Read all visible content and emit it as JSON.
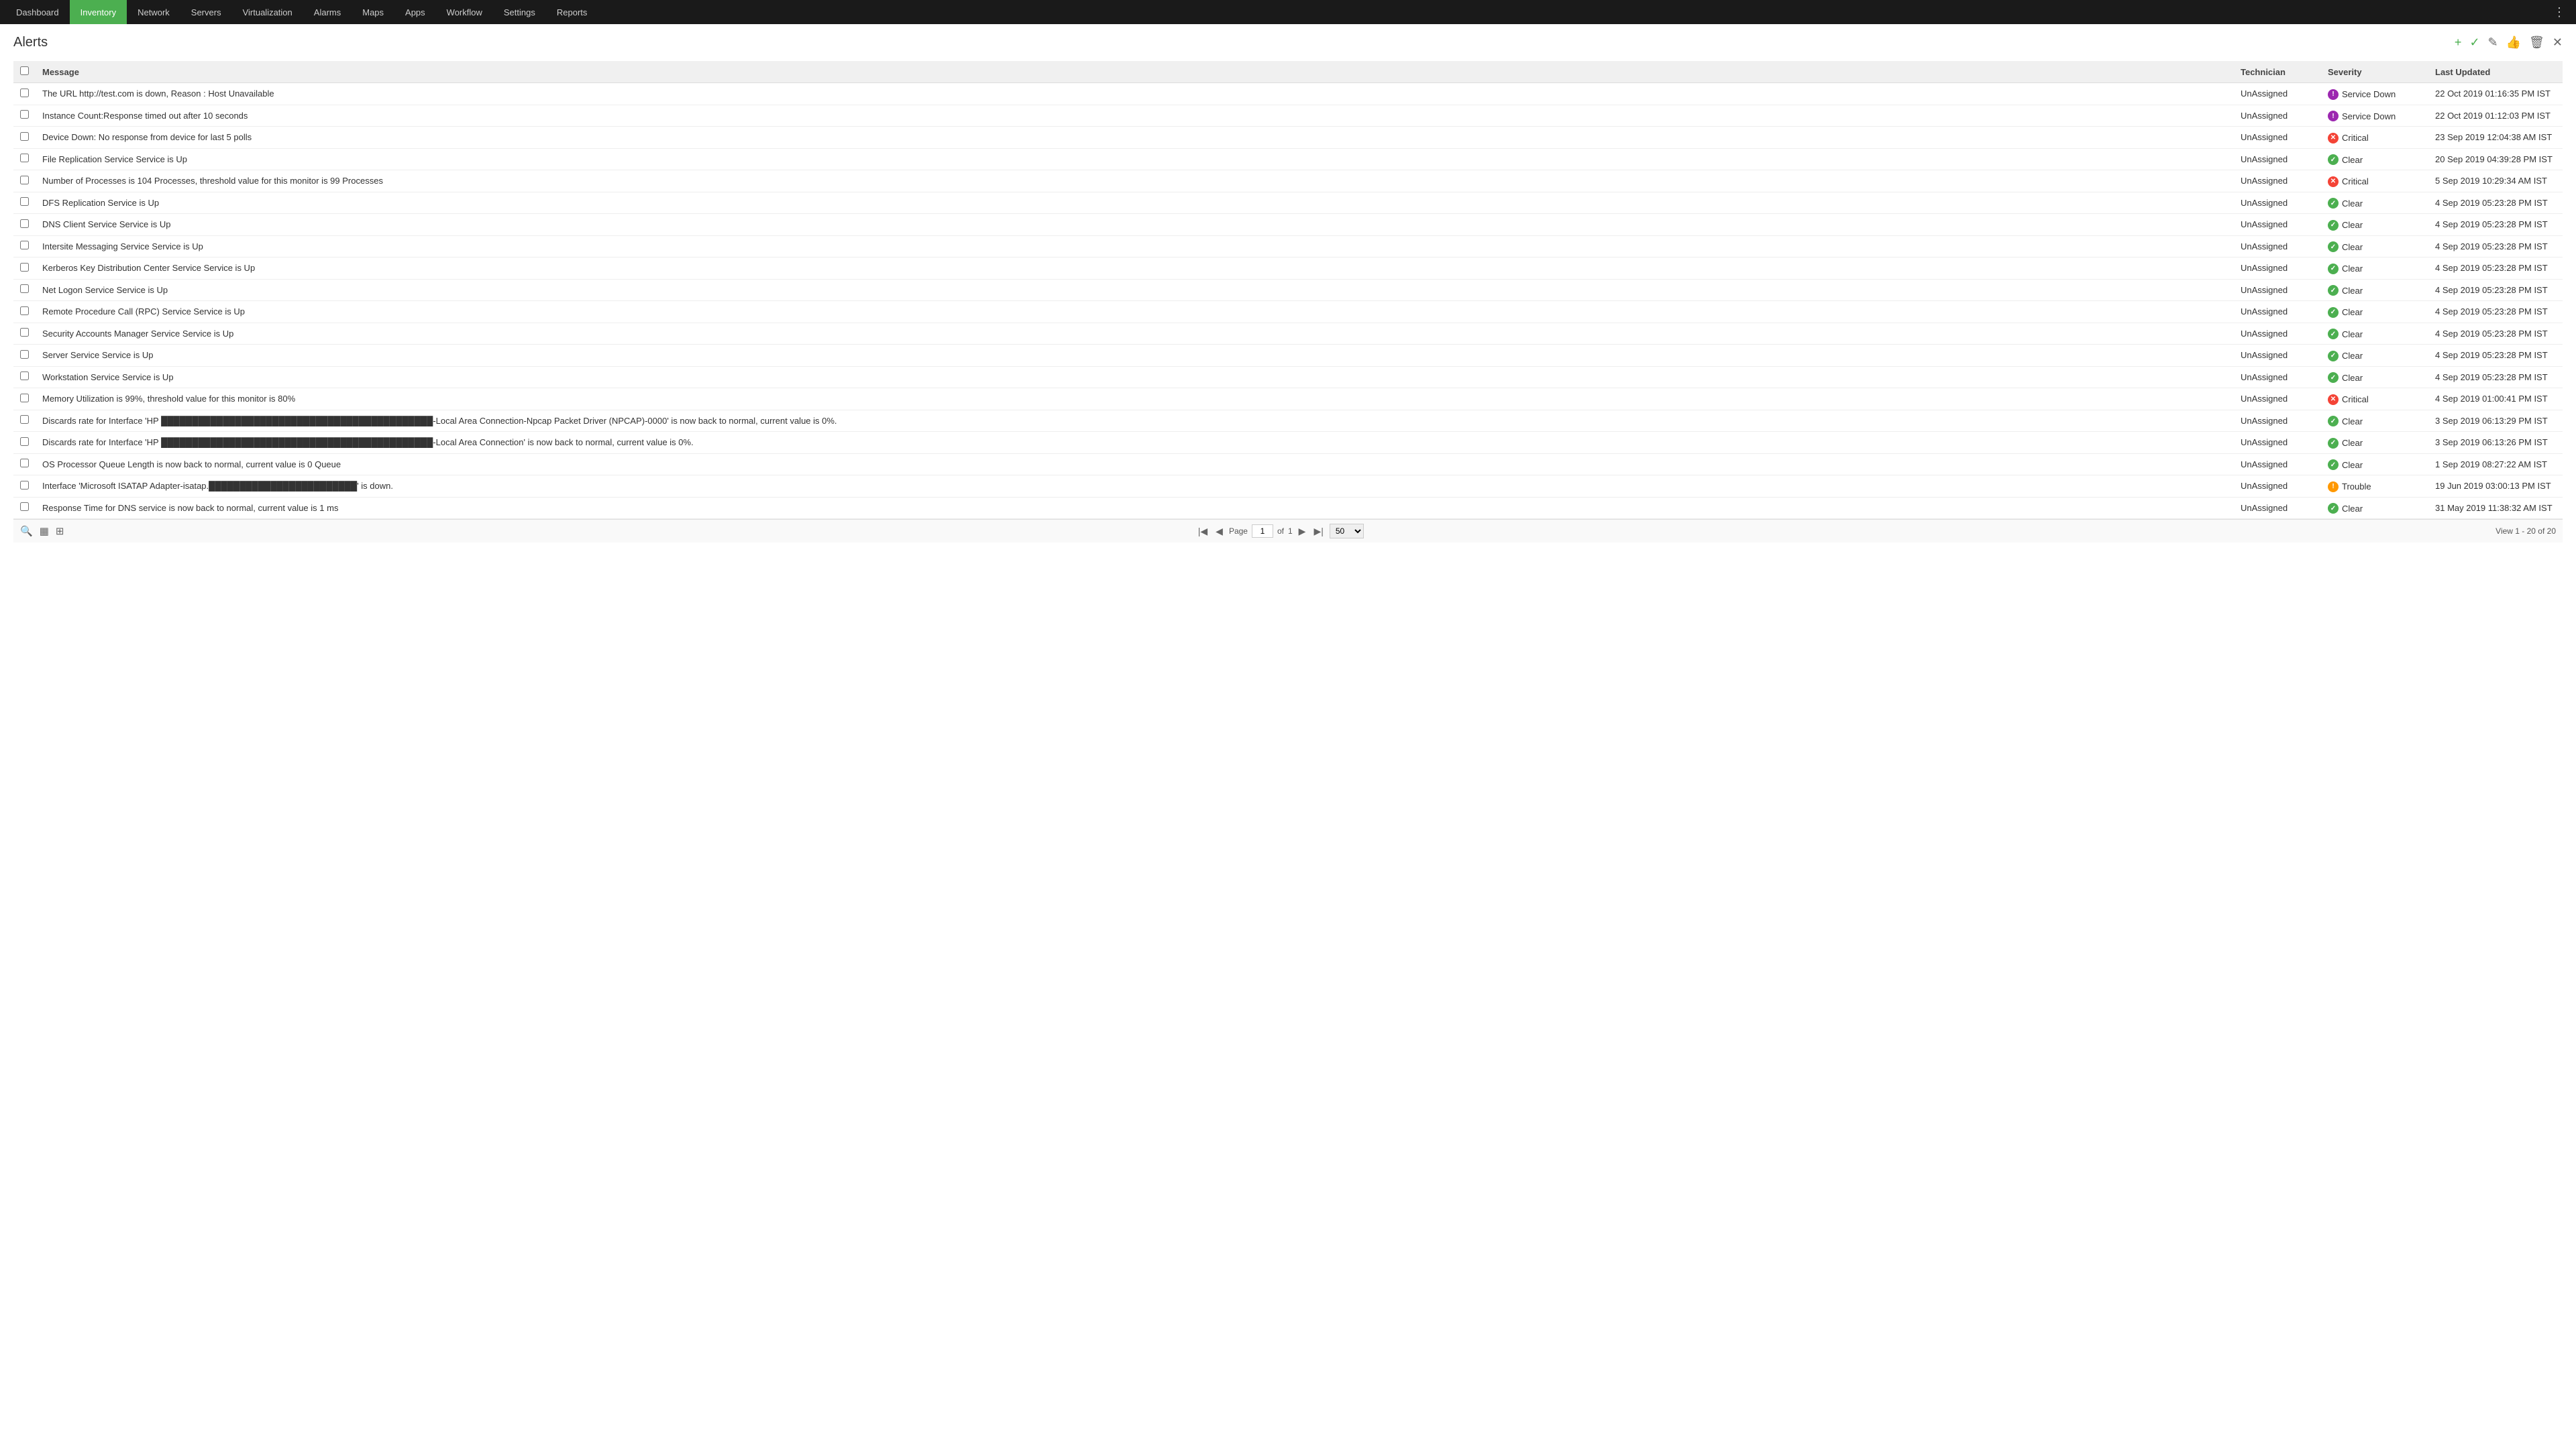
{
  "navbar": {
    "items": [
      {
        "label": "Dashboard",
        "active": false
      },
      {
        "label": "Inventory",
        "active": true
      },
      {
        "label": "Network",
        "active": false
      },
      {
        "label": "Servers",
        "active": false
      },
      {
        "label": "Virtualization",
        "active": false
      },
      {
        "label": "Alarms",
        "active": false
      },
      {
        "label": "Maps",
        "active": false
      },
      {
        "label": "Apps",
        "active": false
      },
      {
        "label": "Workflow",
        "active": false
      },
      {
        "label": "Settings",
        "active": false
      },
      {
        "label": "Reports",
        "active": false
      }
    ]
  },
  "page": {
    "title": "Alerts"
  },
  "table": {
    "columns": [
      "",
      "Message",
      "Technician",
      "Severity",
      "Last Updated"
    ],
    "rows": [
      {
        "message": "The URL http://test.com is down, Reason : Host Unavailable",
        "technician": "UnAssigned",
        "severity": "Service Down",
        "severity_type": "service-down",
        "last_updated": "22 Oct 2019 01:16:35 PM IST"
      },
      {
        "message": "Instance Count:Response timed out after 10 seconds",
        "technician": "UnAssigned",
        "severity": "Service Down",
        "severity_type": "service-down",
        "last_updated": "22 Oct 2019 01:12:03 PM IST"
      },
      {
        "message": "Device Down: No response from device for last 5 polls",
        "technician": "UnAssigned",
        "severity": "Critical",
        "severity_type": "critical",
        "last_updated": "23 Sep 2019 12:04:38 AM IST"
      },
      {
        "message": "File Replication Service Service is Up",
        "technician": "UnAssigned",
        "severity": "Clear",
        "severity_type": "clear",
        "last_updated": "20 Sep 2019 04:39:28 PM IST"
      },
      {
        "message": "Number of Processes is 104 Processes, threshold value for this monitor is 99 Processes",
        "technician": "UnAssigned",
        "severity": "Critical",
        "severity_type": "critical",
        "last_updated": "5 Sep 2019 10:29:34 AM IST"
      },
      {
        "message": "DFS Replication Service is Up",
        "technician": "UnAssigned",
        "severity": "Clear",
        "severity_type": "clear",
        "last_updated": "4 Sep 2019 05:23:28 PM IST"
      },
      {
        "message": "DNS Client Service Service is Up",
        "technician": "UnAssigned",
        "severity": "Clear",
        "severity_type": "clear",
        "last_updated": "4 Sep 2019 05:23:28 PM IST"
      },
      {
        "message": "Intersite Messaging Service Service is Up",
        "technician": "UnAssigned",
        "severity": "Clear",
        "severity_type": "clear",
        "last_updated": "4 Sep 2019 05:23:28 PM IST"
      },
      {
        "message": "Kerberos Key Distribution Center Service Service is Up",
        "technician": "UnAssigned",
        "severity": "Clear",
        "severity_type": "clear",
        "last_updated": "4 Sep 2019 05:23:28 PM IST"
      },
      {
        "message": "Net Logon Service Service is Up",
        "technician": "UnAssigned",
        "severity": "Clear",
        "severity_type": "clear",
        "last_updated": "4 Sep 2019 05:23:28 PM IST"
      },
      {
        "message": "Remote Procedure Call (RPC) Service Service is Up",
        "technician": "UnAssigned",
        "severity": "Clear",
        "severity_type": "clear",
        "last_updated": "4 Sep 2019 05:23:28 PM IST"
      },
      {
        "message": "Security Accounts Manager Service Service is Up",
        "technician": "UnAssigned",
        "severity": "Clear",
        "severity_type": "clear",
        "last_updated": "4 Sep 2019 05:23:28 PM IST"
      },
      {
        "message": "Server Service Service is Up",
        "technician": "UnAssigned",
        "severity": "Clear",
        "severity_type": "clear",
        "last_updated": "4 Sep 2019 05:23:28 PM IST"
      },
      {
        "message": "Workstation Service Service is Up",
        "technician": "UnAssigned",
        "severity": "Clear",
        "severity_type": "clear",
        "last_updated": "4 Sep 2019 05:23:28 PM IST"
      },
      {
        "message": "Memory Utilization is 99%, threshold value for this monitor is 80%",
        "technician": "UnAssigned",
        "severity": "Critical",
        "severity_type": "critical",
        "last_updated": "4 Sep 2019 01:00:41 PM IST"
      },
      {
        "message": "Discards rate for Interface 'HP ████████████████████████████████████████████-Local Area Connection-Npcap Packet Driver (NPCAP)-0000' is now back to normal, current value is 0%.",
        "technician": "UnAssigned",
        "severity": "Clear",
        "severity_type": "clear",
        "last_updated": "3 Sep 2019 06:13:29 PM IST"
      },
      {
        "message": "Discards rate for Interface 'HP ████████████████████████████████████████████-Local Area Connection' is now back to normal, current value is 0%.",
        "technician": "UnAssigned",
        "severity": "Clear",
        "severity_type": "clear",
        "last_updated": "3 Sep 2019 06:13:26 PM IST"
      },
      {
        "message": "OS Processor Queue Length is now back to normal, current value is 0 Queue",
        "technician": "UnAssigned",
        "severity": "Clear",
        "severity_type": "clear",
        "last_updated": "1 Sep 2019 08:27:22 AM IST"
      },
      {
        "message": "Interface 'Microsoft ISATAP Adapter-isatap.████████████████████████' is down.",
        "technician": "UnAssigned",
        "severity": "Trouble",
        "severity_type": "trouble",
        "last_updated": "19 Jun 2019 03:00:13 PM IST"
      },
      {
        "message": "Response Time for DNS service is now back to normal, current value is 1 ms",
        "technician": "UnAssigned",
        "severity": "Clear",
        "severity_type": "clear",
        "last_updated": "31 May 2019 11:38:32 AM IST"
      }
    ]
  },
  "footer": {
    "page_label": "Page",
    "current_page": "1",
    "of_label": "of",
    "total_pages": "1",
    "page_size": "50",
    "view_label": "View 1 - 20 of 20"
  },
  "header_actions": {
    "add": "+",
    "approve": "✓",
    "edit": "✎",
    "thumbsup": "👍",
    "delete": "🗑",
    "close": "✕"
  }
}
